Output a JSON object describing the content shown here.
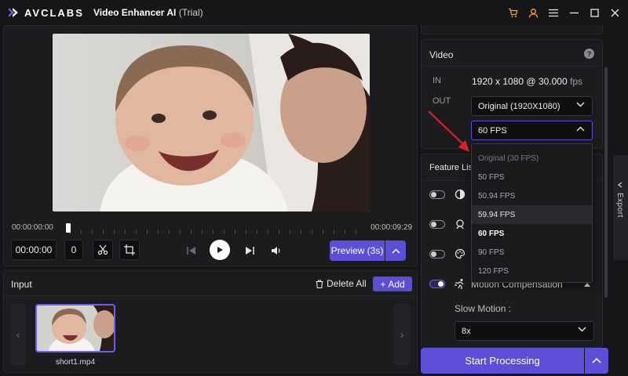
{
  "app": {
    "brand": "AVCLABS",
    "title": "Video Enhancer AI",
    "trial": "(Trial)"
  },
  "titlebar_icons": [
    "cart-icon",
    "user-icon",
    "menu-icon",
    "minimize-icon",
    "maximize-icon",
    "close-icon"
  ],
  "preview": {
    "time_start": "00:00:00:00",
    "time_end": "00:00:09:29",
    "timecode": "00:00:00",
    "frame": "0",
    "preview_label": "Preview (3s)",
    "playhead_fraction": 0.0
  },
  "input": {
    "title": "Input",
    "delete_all": "Delete All",
    "add": "Add",
    "files": [
      {
        "name": "short1.mp4"
      }
    ]
  },
  "video_settings": {
    "title": "Video",
    "help": "?",
    "in_label": "IN",
    "out_label": "OUT",
    "in_resolution": "1920 x 1080",
    "in_at": "@",
    "in_fps": "30.000",
    "in_fps_unit": "fps",
    "out_resolution": "Original (1920X1080)",
    "out_fps": "60 FPS"
  },
  "fps_options": [
    {
      "label": "Original (30 FPS)",
      "state": "muted"
    },
    {
      "label": "50 FPS",
      "state": "normal"
    },
    {
      "label": "50.94 FPS",
      "state": "normal"
    },
    {
      "label": "59.94 FPS",
      "state": "hover"
    },
    {
      "label": "60 FPS",
      "state": "selected"
    },
    {
      "label": "90 FPS",
      "state": "normal"
    },
    {
      "label": "120 FPS",
      "state": "normal"
    }
  ],
  "features": {
    "title": "Feature List",
    "motion_compensation": "Motion Compensation",
    "slow_motion_label": "Slow Motion :",
    "slow_motion_value": "8x"
  },
  "export_label": "Export",
  "start_processing": "Start Processing",
  "colors": {
    "accent": "#5a4fd6",
    "background": "#161618",
    "panel": "#1c1c1f",
    "annotation_arrow": "#e02020"
  }
}
